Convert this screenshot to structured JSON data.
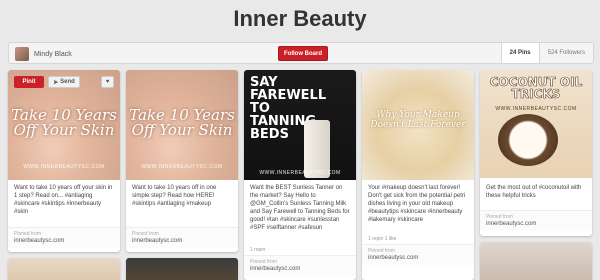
{
  "board": {
    "title": "Inner Beauty",
    "owner": "Mindy Black",
    "follow_label": "Follow Board",
    "pins_count": "24 Pins",
    "followers_count": "524 Followers"
  },
  "pin_buttons": {
    "pinit": "Pinit",
    "send": "Send",
    "like": "♥"
  },
  "pins": [
    {
      "image_text": "Take 10 Years Off Your Skin",
      "watermark": "WWW.INNERBEAUTYSC.COM",
      "description": "Want to take 10 years off your skin in 1 step? Read on... #antiaging #skincare #skintips #innerbeauty #skin",
      "source_label": "Pinned from",
      "source_site": "innerbeautysc.com"
    },
    {
      "image_text": "Take 10 Years Off Your Skin",
      "watermark": "WWW.INNERBEAUTYSC.COM",
      "description": "Want to take 10 years off in one simple step? Read how HERE! #skintips #antiaging #makeup",
      "source_label": "Pinned from",
      "source_site": "innerbeautysc.com"
    },
    {
      "image_text": "SAY FAREWELL TO TANNING BEDS",
      "watermark": "WWW.INNERBEAUTYSC.COM",
      "description": "Want the BEST Sunless Tanner on the market? Say Hello to @GM_Collin's Sunless Tanning Milk and Say Farewell to Tanning Beds for good! #tan #skincare #sunlesstan #SPF #selftanner #safesun",
      "meta": "1 repin",
      "source_label": "Pinned from",
      "source_site": "innerbeautysc.com"
    },
    {
      "image_text": "Why Your Makeup Doesn't Last Forever",
      "watermark": "",
      "description": "Your #makeup doesn't last forever! Don't get sick from the potential petri dishes living in your old makeup #beautytips #skincare #innerbeauty #lakemary #skincare",
      "meta": "1 repin   1 like",
      "source_label": "Pinned from",
      "source_site": "innerbeautysc.com"
    },
    {
      "image_text": "COCONUT OIL TRICKS",
      "watermark": "WWW.INNERBEAUTYSC.COM",
      "description": "Get the most out of #coconutoil with these helpful tricks",
      "source_label": "Pinned from",
      "source_site": "innerbeautysc.com"
    }
  ]
}
